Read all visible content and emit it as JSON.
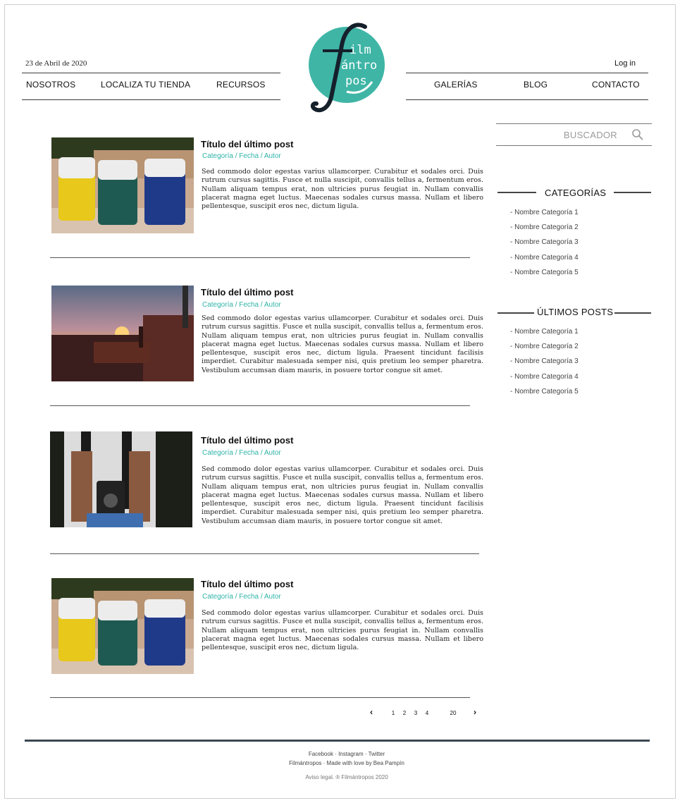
{
  "header": {
    "date": "23 de Abril de 2020",
    "login": "Log in",
    "nav_left": [
      "NOSOTROS",
      "LOCALIZA TU TIENDA",
      "RECURSOS"
    ],
    "nav_right": [
      "GALERÍAS",
      "BLOG",
      "CONTACTO"
    ],
    "logo_lines": [
      "ilm",
      "ántro",
      "pos"
    ],
    "logo_colors": {
      "circle": "#3fb5a6",
      "f": "#15202b",
      "text": "#ffffff"
    }
  },
  "search": {
    "placeholder": "BUSCADOR",
    "icon": "search-icon"
  },
  "sidebar": {
    "categories_title": "CATEGORÍAS",
    "categories": [
      "- Nombre Categoría 1",
      "- Nombre Categoría 2",
      "- Nombre Categoría 3",
      "- Nombre Categoría 4",
      "- Nombre Categoría 5"
    ],
    "latest_title": "ÚLTIMOS POSTS",
    "latest": [
      "- Nombre Categoría 1",
      "- Nombre Categoría 2",
      "- Nombre Categoría 3",
      "- Nombre Categoría 4",
      "- Nombre Categoría 5"
    ]
  },
  "posts": [
    {
      "title": "Título del último post",
      "meta": "Categoría / Fecha / Autor",
      "body": "Sed commodo dolor egestas varius ullamcorper. Curabitur et sodales orci. Duis rutrum cursus sagittis. Fusce et nulla suscipit, convallis tellus a, fermentum eros. Nullam aliquam tempus erat, non ultricies purus feugiat in. Nullam convallis placerat magna eget luctus. Maecenas sodales cursus massa. Nullam et libero pellentesque, suscipit eros nec, dictum ligula.",
      "image": "barrels-photo"
    },
    {
      "title": "Título del último post",
      "meta": "Categoría / Fecha / Autor",
      "body": "Sed commodo dolor egestas varius ullamcorper. Curabitur et sodales orci. Duis rutrum cursus sagittis. Fusce et nulla suscipit, convallis tellus a, fermentum eros. Nullam aliquam tempus erat, non ultricies purus feugiat in. Nullam convallis placerat magna eget luctus. Maecenas sodales cursus massa. Nullam et libero pellentesque, suscipit eros nec, dictum ligula. Praesent tincidunt facilisis imperdiet. Curabitur malesuada semper nisi, quis pretium leo semper pharetra. Vestibulum accumsan diam mauris, in posuere tortor congue sit amet.",
      "image": "sunset-rooftops-photo"
    },
    {
      "title": "Título del último post",
      "meta": "Categoría / Fecha / Autor",
      "body": "Sed commodo dolor egestas varius ullamcorper. Curabitur et sodales orci. Duis rutrum cursus sagittis. Fusce et nulla suscipit, convallis tellus a, fermentum eros. Nullam aliquam tempus erat, non ultricies purus feugiat in. Nullam convallis placerat magna eget luctus. Maecenas sodales cursus massa. Nullam et libero pellentesque, suscipit eros nec, dictum ligula. Praesent tincidunt facilisis imperdiet. Curabitur malesuada semper nisi, quis pretium leo semper pharetra. Vestibulum accumsan diam mauris, in posuere tortor congue sit amet.",
      "image": "camera-strap-photo"
    },
    {
      "title": "Título del último post",
      "meta": "Categoría / Fecha / Autor",
      "body": "Sed commodo dolor egestas varius ullamcorper. Curabitur et sodales orci. Duis rutrum cursus sagittis. Fusce et nulla suscipit, convallis tellus a, fermentum eros. Nullam aliquam tempus erat, non ultricies purus feugiat in. Nullam convallis placerat magna eget luctus. Maecenas sodales cursus massa. Nullam et libero pellentesque, suscipit eros nec, dictum ligula.",
      "image": "barrels-photo"
    }
  ],
  "pagination": {
    "prev": "‹",
    "pages": [
      "1",
      "2",
      "3",
      "4",
      "20"
    ],
    "next": "›"
  },
  "footer": {
    "social": [
      "Facebook",
      "Instagram",
      "Twitter"
    ],
    "sep": " · ",
    "brand": "Filmántropos",
    "credit": "Made with love by Bea Pampín",
    "legal": "Aviso legal. ® Filmántropos 2020"
  }
}
